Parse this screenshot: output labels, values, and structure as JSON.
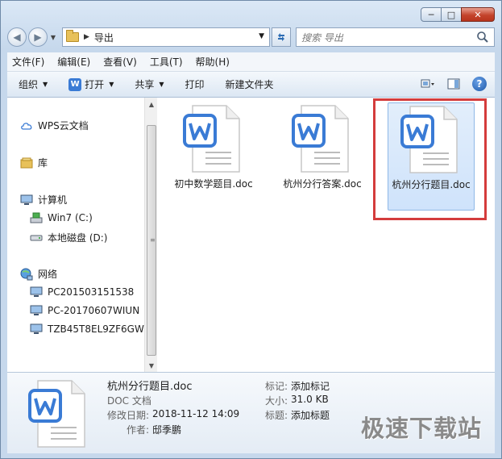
{
  "window": {
    "minimize": "─",
    "maximize": "□",
    "close": "✕"
  },
  "nav": {
    "back": "◀",
    "forward": "▶",
    "address": "导出",
    "search_placeholder": "搜索 导出"
  },
  "menubar": [
    "文件(F)",
    "编辑(E)",
    "查看(V)",
    "工具(T)",
    "帮助(H)"
  ],
  "commands": {
    "organize": "组织",
    "open": "打开",
    "share": "共享",
    "print": "打印",
    "new_folder": "新建文件夹"
  },
  "navpane": {
    "wps_cloud": "WPS云文档",
    "library": "库",
    "computer": "计算机",
    "drive_c": "Win7 (C:)",
    "drive_d": "本地磁盘 (D:)",
    "network": "网络",
    "pcs": [
      "PC201503151538",
      "PC-20170607WIUN",
      "TZB45T8EL9ZF6GW"
    ]
  },
  "files": [
    {
      "name": "初中数学题目.doc",
      "selected": false
    },
    {
      "name": "杭州分行答案.doc",
      "selected": false
    },
    {
      "name": "杭州分行题目.doc",
      "selected": true
    }
  ],
  "details": {
    "name": "杭州分行题目.doc",
    "type": "DOC 文档",
    "modified_label": "修改日期:",
    "modified_value": "2018-11-12 14:09",
    "author_label": "作者:",
    "author_value": "邸季鹏",
    "tag_label": "标记:",
    "tag_value": "添加标记",
    "size_label": "大小:",
    "size_value": "31.0 KB",
    "title_label": "标题:",
    "title_value": "添加标题"
  },
  "watermark": "极速下载站",
  "colors": {
    "wps_blue": "#3a7bd5",
    "highlight_red": "#d43c3c",
    "selection": "#cfe3fb"
  }
}
